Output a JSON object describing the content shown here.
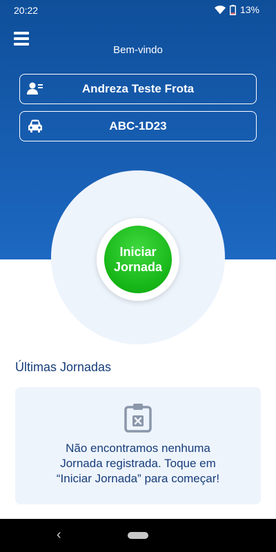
{
  "status_bar": {
    "time": "20:22",
    "battery": "13%",
    "icons": [
      "wifi-icon",
      "battery-icon"
    ]
  },
  "header": {
    "welcome": "Bem-vindo",
    "menu_icon": "hamburger-menu-icon",
    "driver_name": "Andreza Teste Frota",
    "vehicle_plate": "ABC-1D23"
  },
  "start_button": {
    "line1": "Iniciar",
    "line2": "Jornada"
  },
  "recent": {
    "title": "Últimas Jornadas",
    "empty_icon": "clipboard-x-icon",
    "empty_line1": "Não encontramos nenhuma",
    "empty_line2": "Jornada registrada. Toque em",
    "empty_line3": "“Iniciar Jornada” para começar!"
  },
  "nav": {
    "back_glyph": "‹"
  },
  "colors": {
    "header_top": "#0f4f9a",
    "header_bottom": "#1d68c2",
    "start_green": "#16b516",
    "text_navy": "#163d7a",
    "card_bg": "#eef4fc"
  }
}
